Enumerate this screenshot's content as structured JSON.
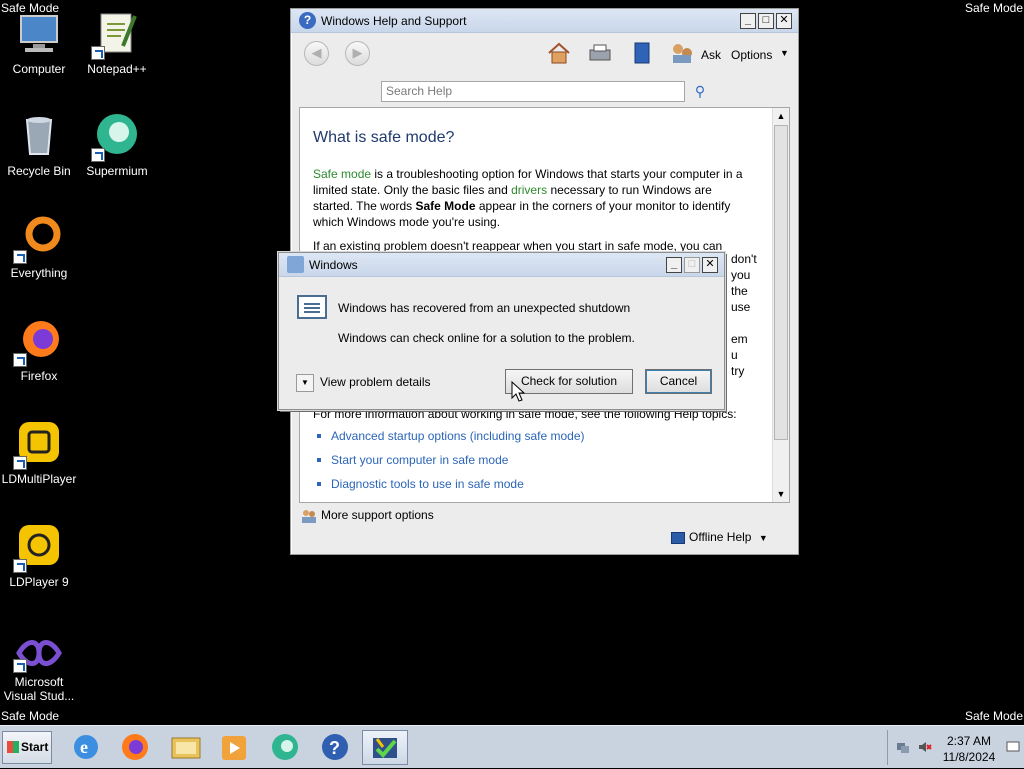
{
  "corners": {
    "top_left": "Safe Mode",
    "top_right": "Safe Mode",
    "bottom_left": "Safe Mode",
    "bottom_right": "Safe Mode"
  },
  "desktop_icons": [
    {
      "label": "Computer",
      "icon": "computer-icon"
    },
    {
      "label": "Notepad++",
      "icon": "notepad-plus-plus-icon"
    },
    {
      "label": "Recycle Bin",
      "icon": "recycle-bin-icon"
    },
    {
      "label": "Supermium",
      "icon": "supermium-icon"
    },
    {
      "label": "Everything",
      "icon": "everything-icon"
    },
    {
      "label": "Firefox",
      "icon": "firefox-icon"
    },
    {
      "label": "LDMultiPlayer",
      "icon": "ldmultiplayer-icon"
    },
    {
      "label": "LDPlayer 9",
      "icon": "ldplayer-icon"
    },
    {
      "label": "Microsoft Visual Stud...",
      "icon": "visual-studio-icon"
    }
  ],
  "help_window": {
    "title": "Windows Help and Support",
    "toolbar": {
      "ask_label": "Ask",
      "options_label": "Options"
    },
    "search_placeholder": "Search Help",
    "article": {
      "heading": "What is safe mode?",
      "p1_link1": "Safe mode",
      "p1_text1": " is a troubleshooting option for Windows that starts your computer in a limited state. Only the basic files and ",
      "p1_link2": "drivers",
      "p1_text2": " necessary to run Windows are started. The words ",
      "p1_bold": "Safe Mode",
      "p1_text3": " appear in the corners of your monitor to identify which Windows mode you're using.",
      "p2_text": "If an existing problem doesn't reappear when you start in safe mode, you can",
      "right_fragments": [
        "don't",
        "you",
        "the",
        "use",
        "",
        "em",
        "u",
        "try"
      ],
      "p3_text": "For more information about working in safe mode, see the following Help topics:",
      "topics": [
        "Advanced startup options (including safe mode)",
        "Start your computer in safe mode",
        "Diagnostic tools to use in safe mode"
      ]
    },
    "more_support": "More support options",
    "offline_help": "Offline Help"
  },
  "dialog": {
    "title": "Windows",
    "line1": "Windows has recovered from an unexpected shutdown",
    "line2": "Windows can check online for a solution to the problem.",
    "details_label": "View problem details",
    "check_button": "Check for solution",
    "cancel_button": "Cancel"
  },
  "taskbar": {
    "start_label": "Start",
    "pinned": [
      "internet-explorer-icon",
      "firefox-icon",
      "file-explorer-icon",
      "media-player-icon",
      "supermium-icon",
      "help-icon",
      "action-center-icon"
    ],
    "clock_time": "2:37 AM",
    "clock_date": "11/8/2024"
  },
  "colors": {
    "desktop": "#000000",
    "link": "#2b65b8",
    "green_link": "#2e8a2e",
    "heading": "#1f3a6e"
  }
}
